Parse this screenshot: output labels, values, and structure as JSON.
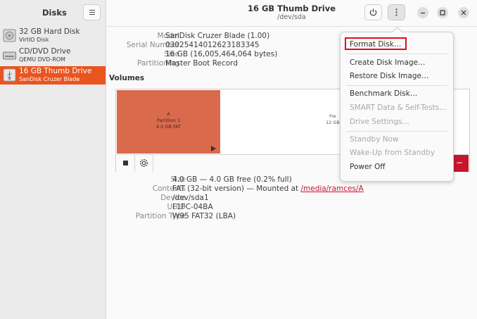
{
  "sidebar": {
    "title": "Disks",
    "drives": [
      {
        "name": "32 GB Hard Disk",
        "model": "VirtIO Disk",
        "icon": "hard-disk-icon"
      },
      {
        "name": "CD/DVD Drive",
        "model": "QEMU DVD-ROM",
        "icon": "optical-drive-icon"
      },
      {
        "name": "16 GB Thumb Drive",
        "model": "SanDisk Cruzer Blade",
        "icon": "usb-drive-icon"
      }
    ]
  },
  "header": {
    "title": "16 GB Thumb Drive",
    "subtitle": "/dev/sda"
  },
  "drive_info": {
    "model_label": "Model",
    "model": "SanDisk Cruzer Blade (1.00)",
    "serial_label": "Serial Number",
    "serial": "03025414012623183345",
    "size_label": "Size",
    "size": "16 GB (16,005,464,064 bytes)",
    "partitioning_label": "Partitioning",
    "partitioning": "Master Boot Record"
  },
  "volumes": {
    "title": "Volumes",
    "partition": {
      "line1": "A",
      "line2": "Partition 1",
      "line3": "4.0 GB FAT"
    },
    "free": {
      "line1": "Fre",
      "line2": "12 GB"
    }
  },
  "partition_info": {
    "size_label": "Size",
    "size": "4.0 GB — 4.0 GB free (0.2% full)",
    "contents_label": "Contents",
    "contents": "FAT (32-bit version) — Mounted at ",
    "mount_link": "/media/ramces/A",
    "device_label": "Device",
    "device": "/dev/sda1",
    "uuid_label": "UUID",
    "uuid": "F1FC-04BA",
    "ptype_label": "Partition Type",
    "ptype": "W95 FAT32 (LBA)"
  },
  "menu": {
    "items": [
      "Format Disk…",
      "Create Disk Image…",
      "Restore Disk Image…",
      "Benchmark Disk…",
      "SMART Data & Self-Tests…",
      "Drive Settings…",
      "Standby Now",
      "Wake-Up from Standby",
      "Power Off"
    ]
  },
  "colors": {
    "accent": "#e9541f",
    "partition": "#d96a4c",
    "danger": "#c7162b",
    "highlight": "#e0101e"
  }
}
